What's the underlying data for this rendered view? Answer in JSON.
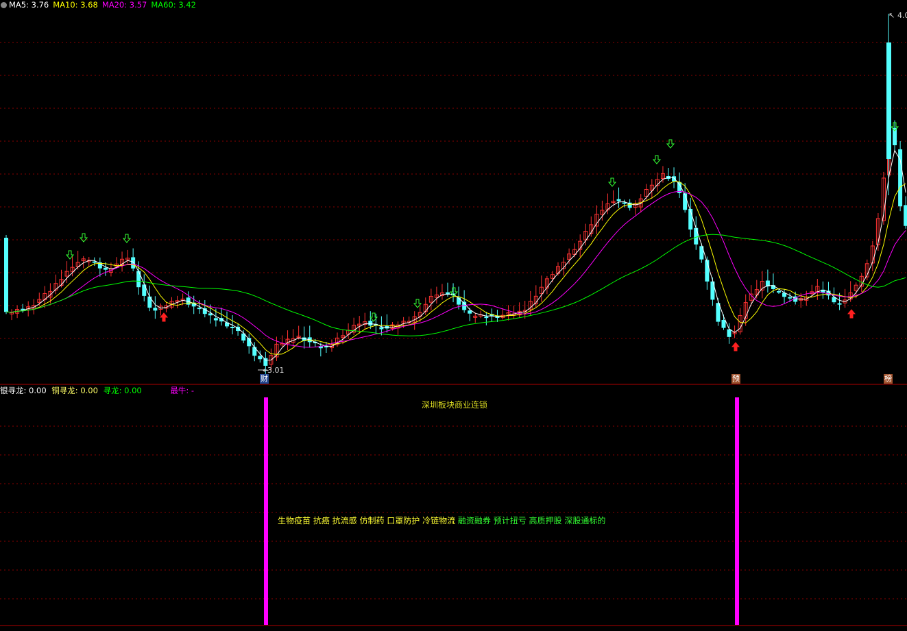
{
  "main_legend": {
    "items": [
      {
        "label": "MA5: 3.76",
        "color": "#ffffff"
      },
      {
        "label": "MA10: 3.68",
        "color": "#ffff00"
      },
      {
        "label": "MA20: 3.57",
        "color": "#ff00ff"
      },
      {
        "label": "MA60: 3.42",
        "color": "#00ff00"
      }
    ]
  },
  "price_labels": {
    "low": "3.01",
    "high": "4.0"
  },
  "event_badges": [
    {
      "label": "财",
      "bg": "#23468f"
    },
    {
      "label": "预",
      "bg": "#a0522d"
    },
    {
      "label": "榜",
      "bg": "#a0522d"
    }
  ],
  "sub_legend": {
    "items": [
      {
        "label": "银寻龙: 0.00",
        "color": "#ffffff"
      },
      {
        "label": "铜寻龙: 0.00",
        "color": "#ffff66"
      },
      {
        "label": "寻龙: 0.00",
        "color": "#00ff00"
      },
      {
        "label": "最牛: -",
        "color": "#ff00ff"
      }
    ]
  },
  "sector_title": "深圳板块商业连锁",
  "concept_tags": {
    "part1": "生物疫苗 抗癌 抗流感 仿制药 口罩防护 冷链物流",
    "part2": "融资融券 预计扭亏 高质押股 深股通标的"
  },
  "colors": {
    "up": "#ff3232",
    "down": "#54ffff",
    "ma5": "#ffffff",
    "ma10": "#ffff00",
    "ma20": "#ff00ff",
    "ma60": "#00ff00",
    "grid": "#8b0000",
    "signal_bar": "#ff00ff",
    "buy_arrow": "#ff2020",
    "sell_arrow": "#33ff33"
  }
}
